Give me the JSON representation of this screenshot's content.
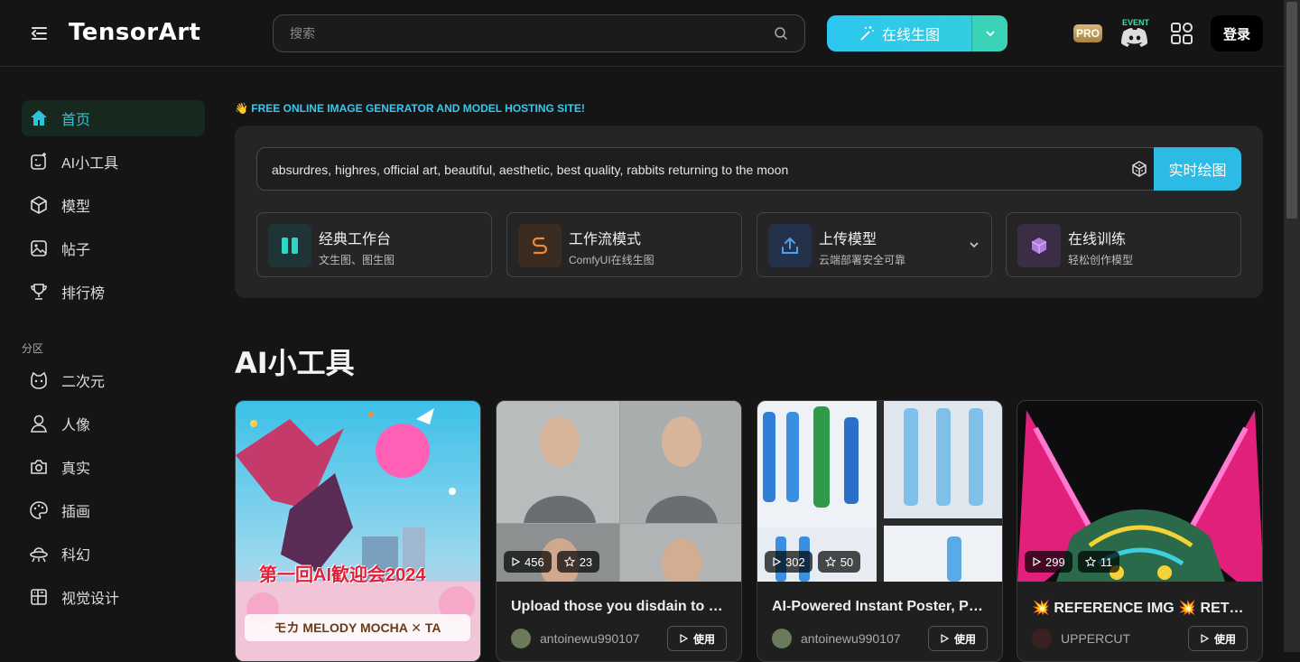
{
  "header": {
    "logo_text": "TensorArt",
    "search_placeholder": "搜索",
    "generate_label": "在线生图",
    "pro_label": "PRO",
    "event_label": "EVENT",
    "login_label": "登录"
  },
  "sidebar": {
    "items": [
      {
        "label": "首页",
        "icon": "home-icon"
      },
      {
        "label": "AI小工具",
        "icon": "ai-tools-icon"
      },
      {
        "label": "模型",
        "icon": "cube-icon"
      },
      {
        "label": "帖子",
        "icon": "image-icon"
      },
      {
        "label": "排行榜",
        "icon": "trophy-icon"
      }
    ],
    "section_label": "分区",
    "sections": [
      {
        "label": "二次元",
        "icon": "anime-face-icon"
      },
      {
        "label": "人像",
        "icon": "person-icon"
      },
      {
        "label": "真实",
        "icon": "camera-icon"
      },
      {
        "label": "插画",
        "icon": "palette-icon"
      },
      {
        "label": "科幻",
        "icon": "ufo-icon"
      },
      {
        "label": "视觉设计",
        "icon": "layout-icon"
      }
    ]
  },
  "main": {
    "tagline": "👋 FREE ONLINE IMAGE GENERATOR AND MODEL HOSTING SITE!",
    "prompt_text": "absurdres, highres, official art, beautiful, aesthetic, best quality, rabbits returning to the moon",
    "live_draw_label": "实时绘图",
    "modes": [
      {
        "title": "经典工作台",
        "subtitle": "文生图、图生图",
        "icon": "workbench-icon",
        "color": "#2fd6c6"
      },
      {
        "title": "工作流模式",
        "subtitle": "ComfyUI在线生图",
        "icon": "workflow-icon",
        "color": "#f08a3a"
      },
      {
        "title": "上传模型",
        "subtitle": "云端部署安全可靠",
        "icon": "upload-icon",
        "color": "#4aa3f0"
      },
      {
        "title": "在线训练",
        "subtitle": "轻松创作模型",
        "icon": "train-cube-icon",
        "color": "#b07ae0"
      }
    ],
    "tools_heading": "AI小工具",
    "cards": [
      {
        "title": "",
        "author": "",
        "runs": "",
        "stars": "",
        "art": "anime-event-poster",
        "banner": "第一回AI歓迎会2024",
        "footer": "モカ MELODY MOCHA ✕ TA"
      },
      {
        "title": "Upload those you disdain to se...",
        "author": "antoinewu990107",
        "runs": "456",
        "stars": "23",
        "use": "使用"
      },
      {
        "title": "AI-Powered Instant Poster, Pro...",
        "author": "antoinewu990107",
        "runs": "302",
        "stars": "50",
        "use": "使用"
      },
      {
        "title": "💥 REFERENCE IMG 💥 RETRO",
        "author": "UPPERCUT",
        "runs": "299",
        "stars": "11",
        "use": "使用"
      }
    ]
  },
  "colors": {
    "accent": "#2ec4d9",
    "background": "#151515",
    "panel": "#252525"
  }
}
